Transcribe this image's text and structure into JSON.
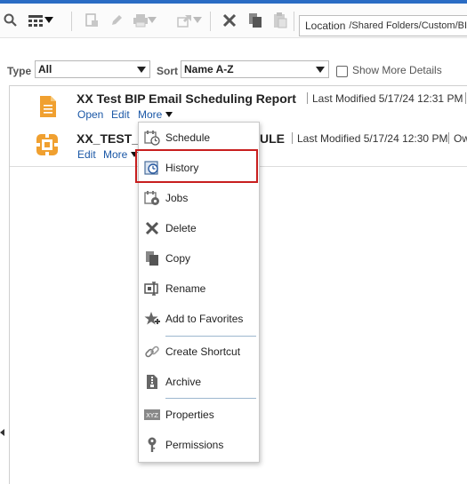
{
  "toolbar": {
    "icons": [
      "search-icon",
      "view-grid-icon",
      "dropdown-caret-icon",
      "report-icon",
      "edit-pencil-icon",
      "print-icon",
      "share-icon",
      "delete-x-icon",
      "copy-icon",
      "paste-icon"
    ],
    "location_label": "Location",
    "location_value": "/Shared Folders/Custom/BIP"
  },
  "filters": {
    "type_label": "Type",
    "type_value": "All",
    "sort_label": "Sort",
    "sort_value": "Name A-Z",
    "show_more_label": "Show More Details"
  },
  "items": [
    {
      "title": "XX Test BIP Email Scheduling Report",
      "modified": "Last Modified 5/17/24 12:31 PM",
      "actions": [
        "Open",
        "Edit",
        "More"
      ]
    },
    {
      "title_start": "XX_TEST_",
      "title_end": "ULE",
      "modified": "Last Modified 5/17/24 12:30 PM",
      "owner_partial": "Ow",
      "actions": [
        "Edit",
        "More"
      ]
    }
  ],
  "context_menu": {
    "items": [
      {
        "label": "Schedule",
        "icon": "schedule-icon"
      },
      {
        "label": "History",
        "icon": "history-icon",
        "highlighted": true
      },
      {
        "label": "Jobs",
        "icon": "jobs-icon"
      },
      {
        "label": "Delete",
        "icon": "delete-icon"
      },
      {
        "label": "Copy",
        "icon": "copy-icon"
      },
      {
        "label": "Rename",
        "icon": "rename-icon"
      },
      {
        "label": "Add to Favorites",
        "icon": "star-plus-icon"
      },
      {
        "label": "Create Shortcut",
        "icon": "shortcut-link-icon"
      },
      {
        "label": "Archive",
        "icon": "archive-icon"
      },
      {
        "label": "Properties",
        "icon": "properties-icon"
      },
      {
        "label": "Permissions",
        "icon": "permissions-key-icon"
      }
    ]
  },
  "colors": {
    "accent_blue": "#2a6cc4",
    "link_blue": "#1a57a6",
    "highlight_red": "#c81e1e",
    "report_icon_orange": "#f0a030"
  }
}
